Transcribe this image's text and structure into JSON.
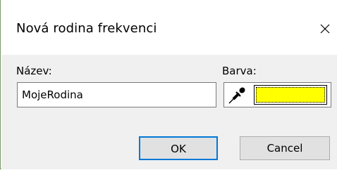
{
  "dialog": {
    "title": "Nová rodina frekvenci",
    "close_icon": "close-icon"
  },
  "form": {
    "name_label": "Název:",
    "name_value": "MojeRodina",
    "color_label": "Barva:",
    "color_value": "#ffff00",
    "picker_icon": "eyedropper-icon"
  },
  "buttons": {
    "ok_label": "OK",
    "cancel_label": "Cancel"
  },
  "colors": {
    "accent": "#0078d7",
    "panel_bg": "#f0f0f0"
  }
}
